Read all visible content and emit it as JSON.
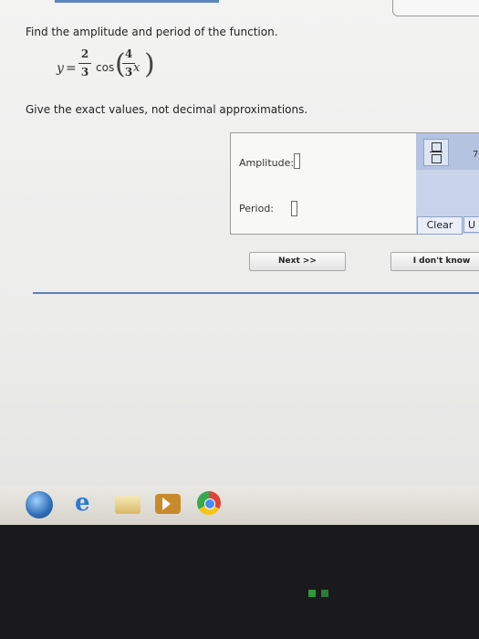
{
  "question": {
    "prompt": "Find the amplitude and period of the function.",
    "equation": {
      "lhs": "y",
      "equals": "=",
      "coef_num": "2",
      "coef_den": "3",
      "func": "cos",
      "paren_open": "(",
      "arg_num": "4",
      "arg_den": "3",
      "var": "x",
      "paren_close": ")"
    },
    "instruction": "Give the exact values, not decimal approximations."
  },
  "answer": {
    "amplitude_label": "Amplitude:",
    "amplitude_value": "",
    "period_label": "Period:",
    "period_value": ""
  },
  "palette": {
    "fraction_icon": "fraction-template-icon",
    "cut_glyph": "7",
    "clear_label": "Clear",
    "undo_label": "U"
  },
  "buttons": {
    "next_label": "Next >>",
    "idk_label": "I don't know"
  },
  "taskbar": {
    "icons": [
      "windows-start-icon",
      "internet-explorer-icon",
      "file-explorer-icon",
      "media-player-icon",
      "chrome-icon"
    ]
  },
  "colors": {
    "divider": "#5c7fb8",
    "palette_bg": "#c8d4ea"
  }
}
